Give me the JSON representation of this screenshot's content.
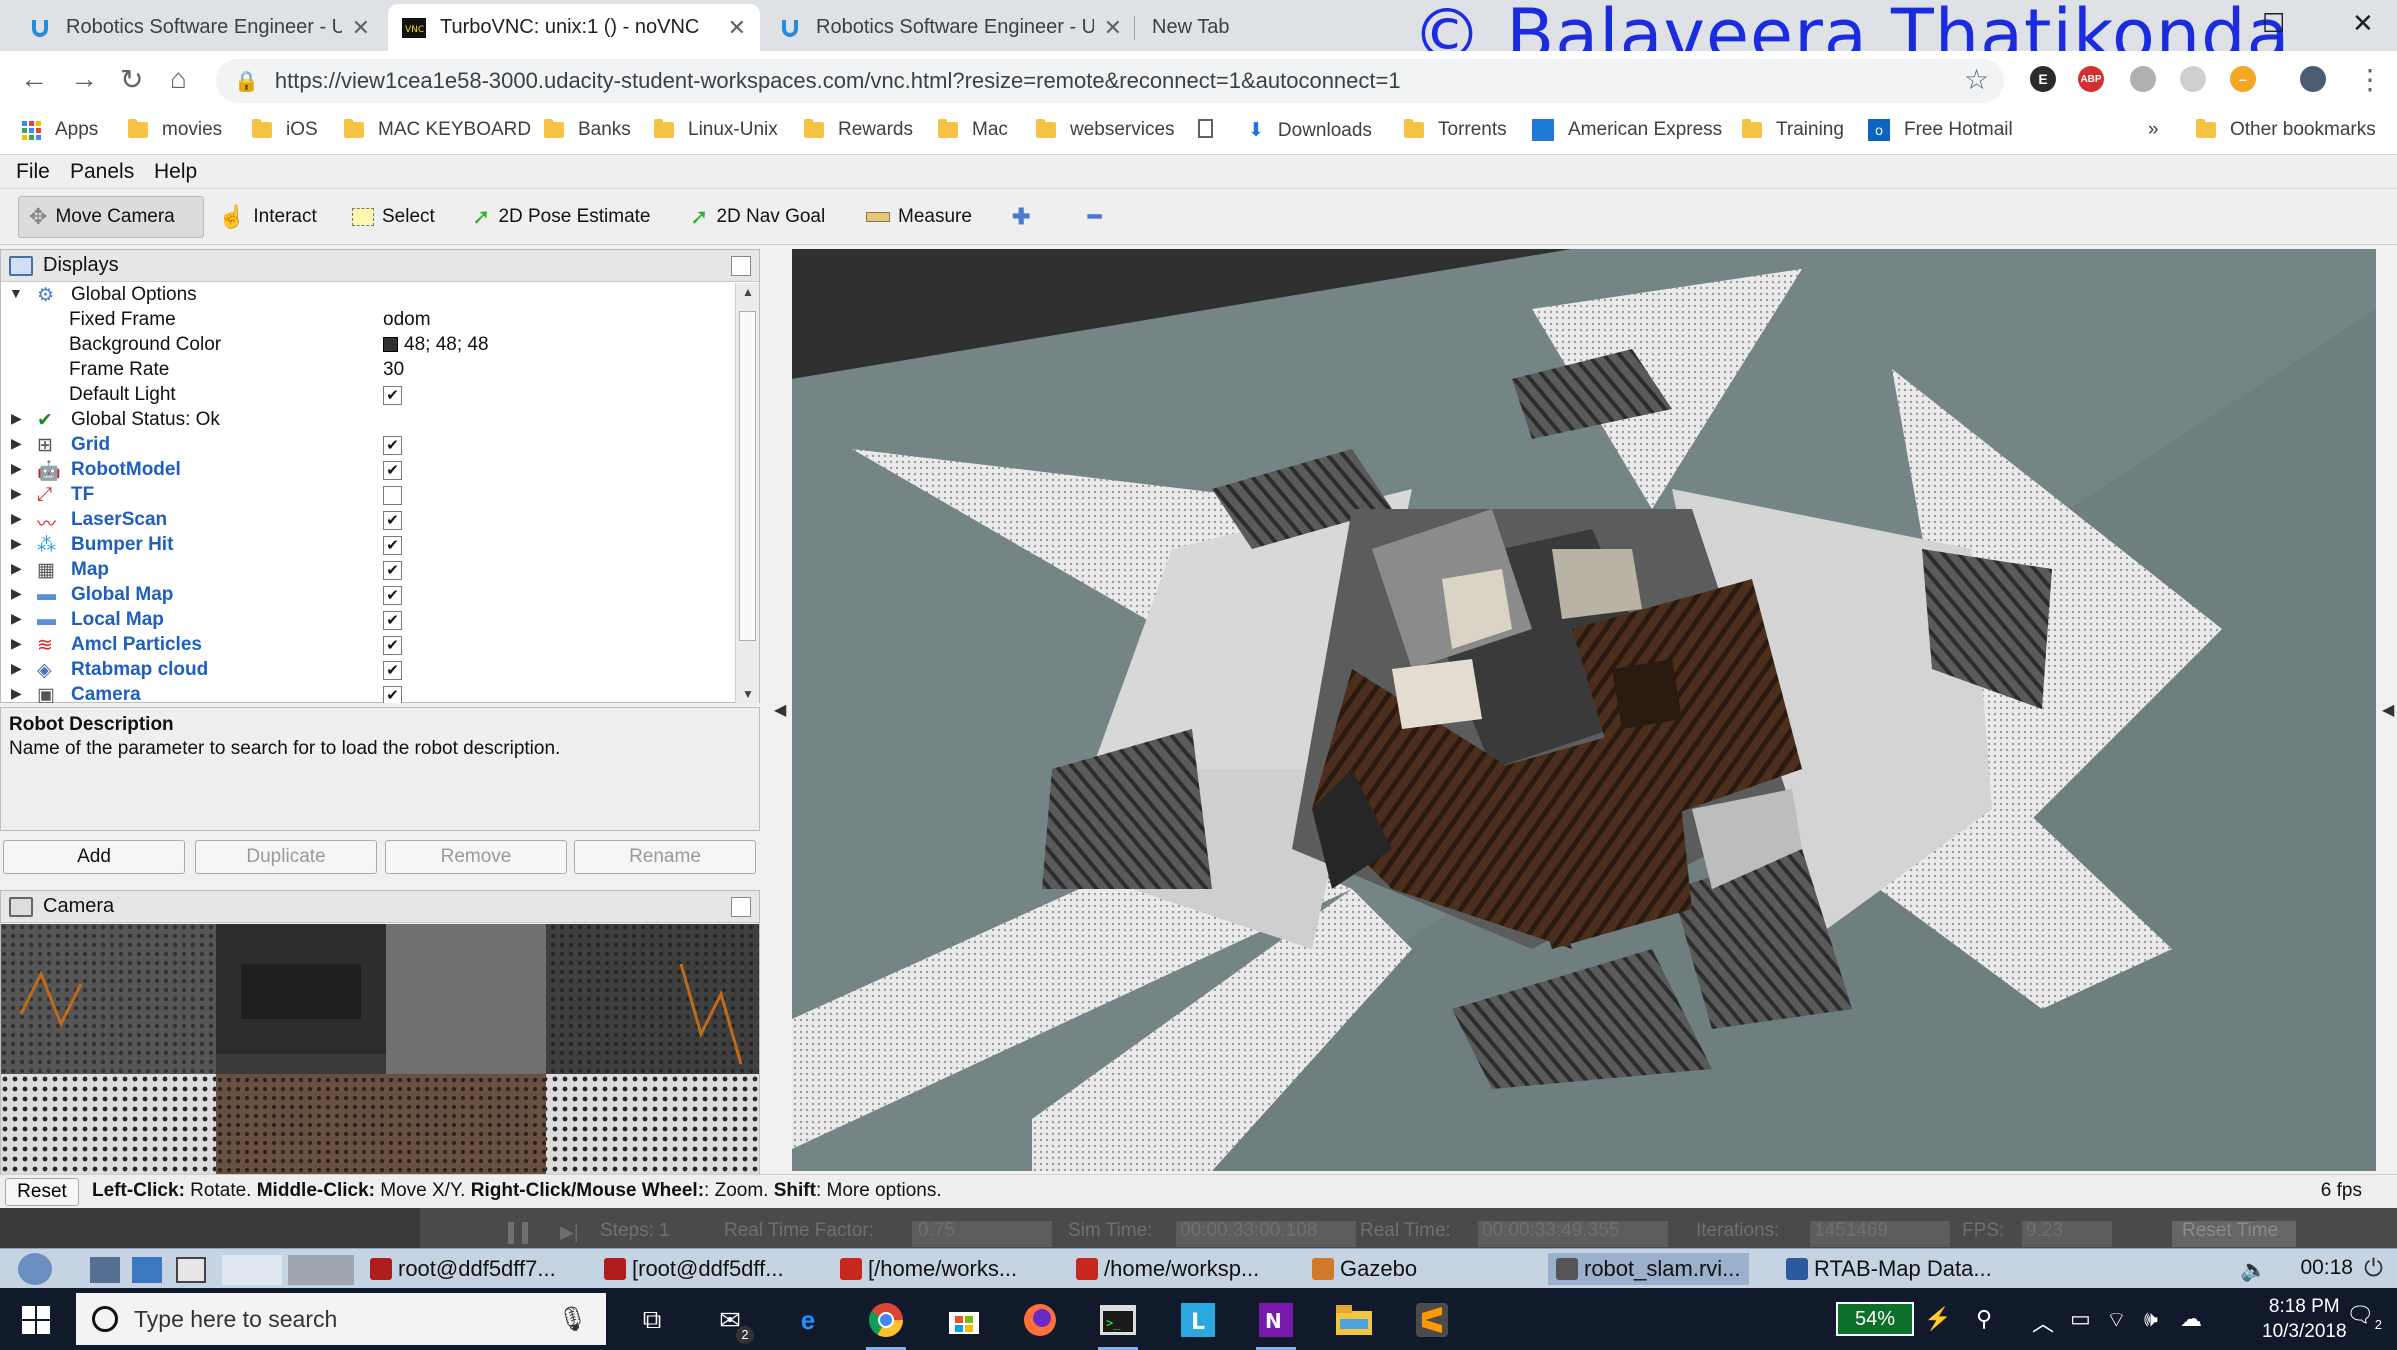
{
  "browser": {
    "tabs": [
      {
        "label": "Robotics Software Engineer - Ud",
        "active": false
      },
      {
        "label": "TurboVNC: unix:1 () - noVNC",
        "active": true
      },
      {
        "label": "Robotics Software Engineer - Ud",
        "active": false
      },
      {
        "label": "New Tab",
        "active": false
      }
    ],
    "watermark": "© Balaveera Thatikonda",
    "url": "https://view1cea1e58-3000.udacity-student-workspaces.com/vnc.html?resize=remote&reconnect=1&autoconnect=1",
    "extensions": [
      "E",
      "ABP"
    ],
    "bookmarks": [
      "Apps",
      "movies",
      "iOS",
      "MAC KEYBOARD",
      "Banks",
      "Linux-Unix",
      "Rewards",
      "Mac",
      "webservices",
      "",
      "Downloads",
      "Torrents",
      "American Express",
      "Training",
      "Free Hotmail"
    ],
    "bookmarks_overflow": "»",
    "other_bookmarks": "Other bookmarks"
  },
  "rviz": {
    "menu": [
      "File",
      "Panels",
      "Help"
    ],
    "tools": [
      "Move Camera",
      "Interact",
      "Select",
      "2D Pose Estimate",
      "2D Nav Goal",
      "Measure"
    ],
    "displays": {
      "title": "Displays",
      "global_options": "Global Options",
      "fixed_frame_label": "Fixed Frame",
      "fixed_frame_value": "odom",
      "bg_color_label": "Background Color",
      "bg_color_value": "48; 48; 48",
      "frame_rate_label": "Frame Rate",
      "frame_rate_value": "30",
      "default_light_label": "Default Light",
      "global_status": "Global Status: Ok",
      "items": [
        {
          "label": "Grid",
          "checked": true
        },
        {
          "label": "RobotModel",
          "checked": true
        },
        {
          "label": "TF",
          "checked": false
        },
        {
          "label": "LaserScan",
          "checked": true
        },
        {
          "label": "Bumper Hit",
          "checked": true
        },
        {
          "label": "Map",
          "checked": true
        },
        {
          "label": "Global Map",
          "checked": true
        },
        {
          "label": "Local Map",
          "checked": true
        },
        {
          "label": "Amcl Particles",
          "checked": true
        },
        {
          "label": "Rtabmap cloud",
          "checked": true
        },
        {
          "label": "Camera",
          "checked": true
        }
      ]
    },
    "description": {
      "title": "Robot Description",
      "text": "Name of the parameter to search for to load the robot description."
    },
    "buttons": [
      "Add",
      "Duplicate",
      "Remove",
      "Rename"
    ],
    "camera_panel_title": "Camera",
    "status": {
      "reset": "Reset",
      "hint_parts": [
        {
          "b": "Left-Click:",
          "t": " Rotate. "
        },
        {
          "b": "Middle-Click:",
          "t": " Move X/Y. "
        },
        {
          "b": "Right-Click/Mouse Wheel:",
          "t": ": Zoom. "
        },
        {
          "b": "Shift",
          "t": ": More options."
        }
      ],
      "fps": "6 fps"
    }
  },
  "gazebo_strip": {
    "items": [
      "Steps: 1",
      "Real Time Factor:",
      "0.75",
      "Sim Time:",
      "00:00:33:00.108",
      "Real Time:",
      "00:00:33:49.355",
      "Iterations:",
      "1451469",
      "FPS:",
      "9.23",
      "Reset Time"
    ]
  },
  "vnc_taskbar": {
    "windows": [
      "root@ddf5dff7...",
      "[root@ddf5dff...",
      "[/home/works...",
      "/home/worksp...",
      "Gazebo",
      "robot_slam.rvi...",
      "RTAB-Map Data..."
    ],
    "clock": "00:18"
  },
  "windows": {
    "search_placeholder": "Type here to search",
    "battery": "54%",
    "time": "8:18 PM",
    "date": "10/3/2018",
    "notif_count": "2",
    "mail_badge": "2"
  }
}
